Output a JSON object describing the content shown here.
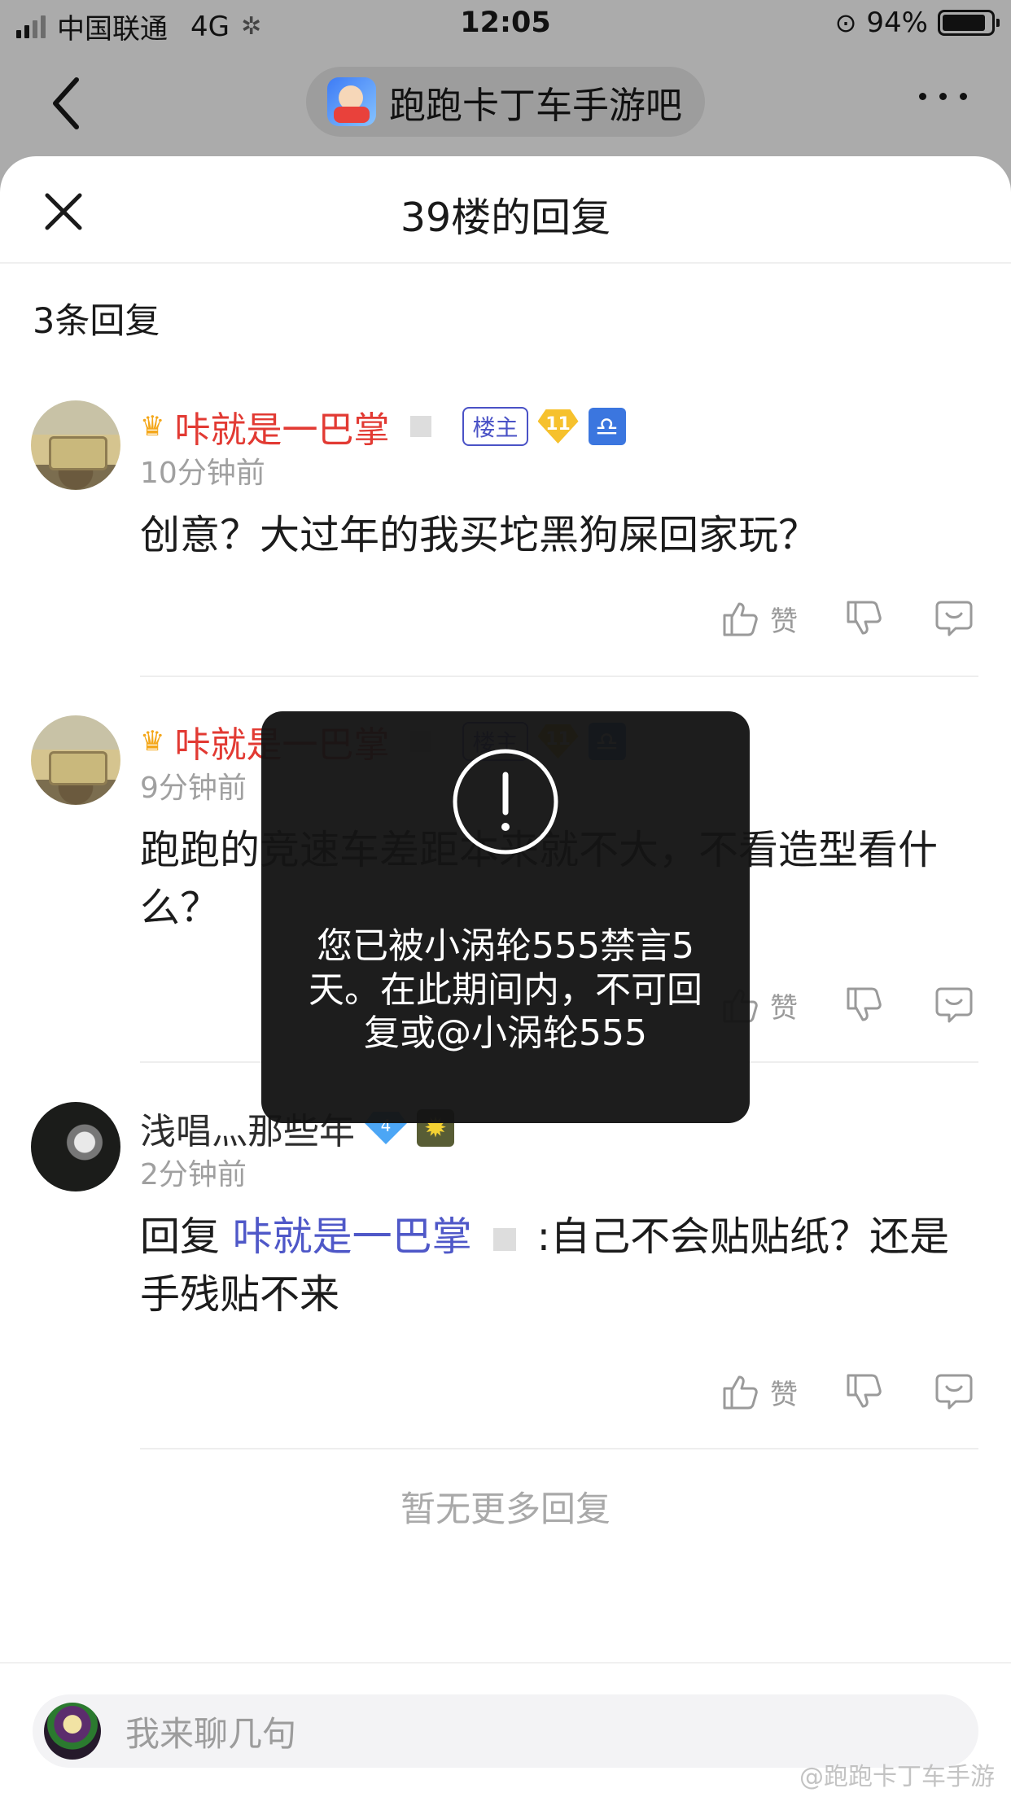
{
  "status_bar": {
    "carrier": "中国联通",
    "network": "4G",
    "time": "12:05",
    "battery": "94%"
  },
  "nav": {
    "title": "跑跑卡丁车手游吧",
    "back_icon": "chevron-left-icon",
    "more_icon": "more-dots-icon"
  },
  "sheet": {
    "title": "39楼的回复",
    "reply_count": "3条回复",
    "close_icon": "close-icon"
  },
  "posts": [
    {
      "username": "咔就是一巴掌",
      "owner_badge": "楼主",
      "level": "11",
      "time": "10分钟前",
      "content": "创意？大过年的我买坨黑狗屎回家玩？",
      "like_label": "赞"
    },
    {
      "username": "咔就是一巴掌",
      "owner_badge": "楼主",
      "level": "11",
      "time": "9分钟前",
      "content": "跑跑的竞速车差距本来就不大，不看造型看什么？",
      "like_label": "赞"
    },
    {
      "username": "浅唱灬那些年",
      "level": "4",
      "time": "2分钟前",
      "reply_prefix": "回复",
      "mention": "咔就是一巴掌",
      "content": ":自己不会贴贴纸？还是手残贴不来",
      "like_label": "赞"
    }
  ],
  "footer": {
    "no_more": "暂无更多回复",
    "input_placeholder": "我来聊几句",
    "watermark": "@跑跑卡丁车手游"
  },
  "toast": {
    "message": "您已被小涡轮555禁言5天。在此期间内，不可回复或@小涡轮555"
  },
  "colors": {
    "username_red": "#e23a33",
    "mention_purple": "#4f58c8",
    "owner_badge": "#4a52c6",
    "dim_overlay": "#ababab"
  }
}
